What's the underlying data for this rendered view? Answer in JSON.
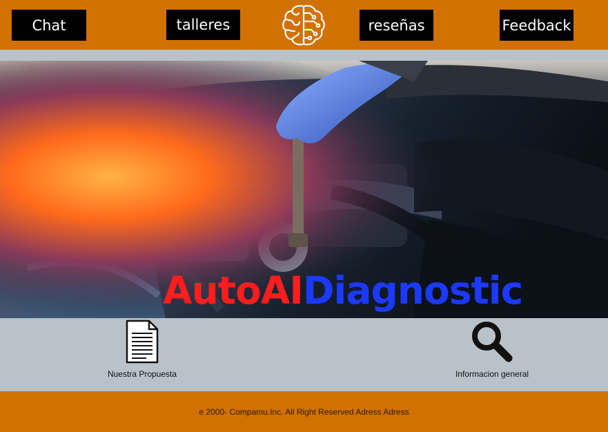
{
  "nav": {
    "chat": "Chat",
    "talleres": "talleres",
    "resenas": "reseñas",
    "feedback": "Feedback",
    "logo_icon": "brain-circuit-icon"
  },
  "hero": {
    "title_part1": "AutoAI",
    "title_part2": "Diagnostic",
    "image": "car-engine-repair-photo"
  },
  "features": [
    {
      "label": "Nuestra Propuesta",
      "icon": "document-icon"
    },
    {
      "label": "Informacion general",
      "icon": "magnifier-icon"
    }
  ],
  "footer": {
    "text": "e 2000- Compamu.Inc. All Right Reserved Adress Adress"
  },
  "colors": {
    "header_bg": "#d17200",
    "nav_btn_bg": "#000000",
    "body_bg": "#b9c2c9",
    "title_red": "#ff1d1d",
    "title_blue": "#1b39ff"
  }
}
